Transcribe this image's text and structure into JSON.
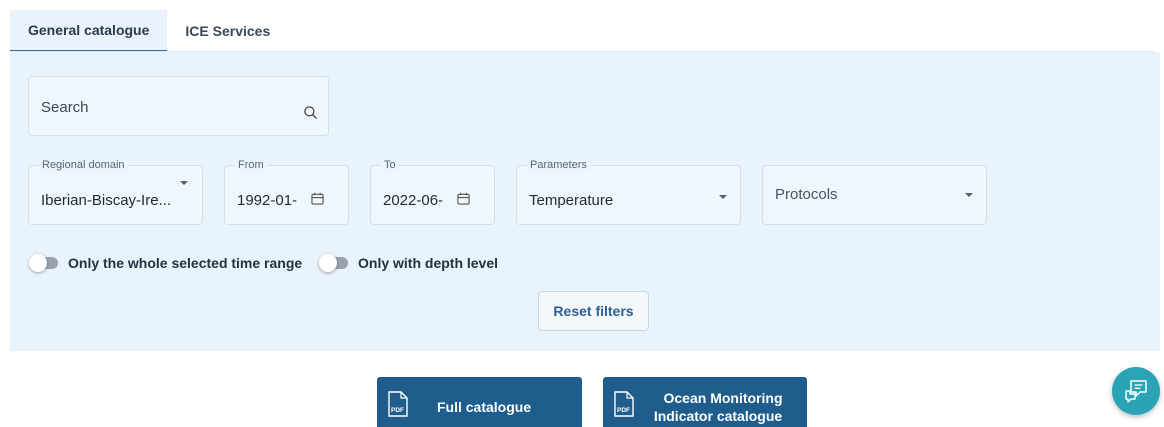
{
  "tabs": [
    {
      "label": "General catalogue",
      "active": true
    },
    {
      "label": "ICE Services",
      "active": false
    }
  ],
  "search": {
    "placeholder": "Search",
    "value": ""
  },
  "fields": {
    "regional_domain": {
      "label": "Regional domain",
      "value": "Iberian-Biscay-Ire..."
    },
    "from": {
      "label": "From",
      "value": "1992-01-"
    },
    "to": {
      "label": "To",
      "value": "2022-06-"
    },
    "parameters": {
      "label": "Parameters",
      "value": "Temperature"
    },
    "protocols": {
      "placeholder": "Protocols"
    }
  },
  "toggles": {
    "whole_time_range": {
      "label": "Only the whole selected time range",
      "checked": false
    },
    "depth_level": {
      "label": "Only with depth level",
      "checked": false
    }
  },
  "reset_label": "Reset filters",
  "catalogue_buttons": {
    "full": {
      "label": "Full catalogue",
      "icon_text": "PDF"
    },
    "omi": {
      "line1": "Ocean Monitoring",
      "line2": "Indicator catalogue",
      "icon_text": "PDF"
    }
  },
  "colors": {
    "filter_panel_bg": "#e8f3fc",
    "primary_button": "#1f5d8d",
    "accent_text": "#2a5f93",
    "chat_button": "#2ba3b5"
  },
  "icons": {
    "search": "search-icon",
    "calendar": "calendar-icon",
    "dropdown": "chevron-down-icon",
    "pdf": "pdf-icon",
    "chat": "chat-icon"
  }
}
